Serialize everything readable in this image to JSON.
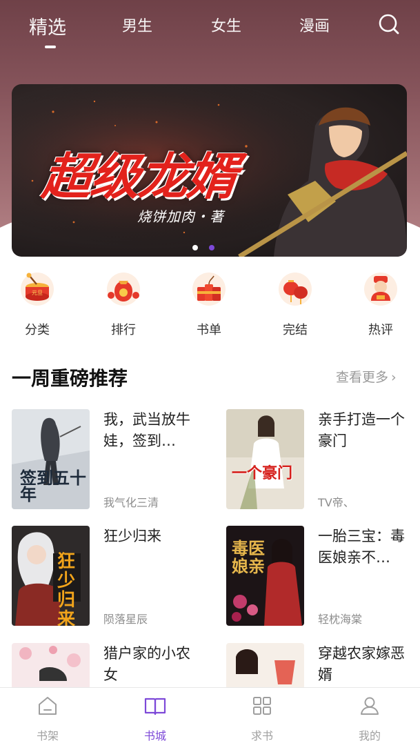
{
  "top_tabs": {
    "items": [
      "精选",
      "男生",
      "女生",
      "漫画"
    ],
    "active_index": 0
  },
  "banner": {
    "title": "超级龙婿",
    "author": "烧饼加肉・著",
    "page_count": 2,
    "active_page": 2,
    "dot_active_color": "#7d49d8"
  },
  "entries": [
    {
      "label": "分类",
      "icon": "category-drum-icon"
    },
    {
      "label": "排行",
      "icon": "ranking-moneybag-icon"
    },
    {
      "label": "书单",
      "icon": "booklist-firecracker-icon"
    },
    {
      "label": "完结",
      "icon": "finished-lantern-icon"
    },
    {
      "label": "热评",
      "icon": "hot-review-god-of-wealth-icon"
    }
  ],
  "section": {
    "title": "一周重磅推荐",
    "more_label": "查看更多"
  },
  "books": [
    {
      "title": "我，武当放牛娃，签到…",
      "author": "我气化三清",
      "cover_text": "签到五十年"
    },
    {
      "title": "亲手打造一个豪门",
      "author": "TV帝、",
      "cover_text": "一个豪门"
    },
    {
      "title": "狂少归来",
      "author": "陨落星辰",
      "cover_text": "狂少归来"
    },
    {
      "title": "一胎三宝：毒医娘亲不…",
      "author": "轻枕海棠",
      "cover_text": "毒医娘亲"
    },
    {
      "title": "猎户家的小农女",
      "author": "",
      "cover_text": ""
    },
    {
      "title": "穿越农家嫁恶婿",
      "author": "",
      "cover_text": ""
    }
  ],
  "bottom_nav": {
    "items": [
      {
        "label": "书架",
        "icon": "bookshelf-icon"
      },
      {
        "label": "书城",
        "icon": "open-book-icon"
      },
      {
        "label": "求书",
        "icon": "grid-icon"
      },
      {
        "label": "我的",
        "icon": "user-icon"
      }
    ],
    "active_index": 1,
    "active_color": "#7d49d8"
  }
}
